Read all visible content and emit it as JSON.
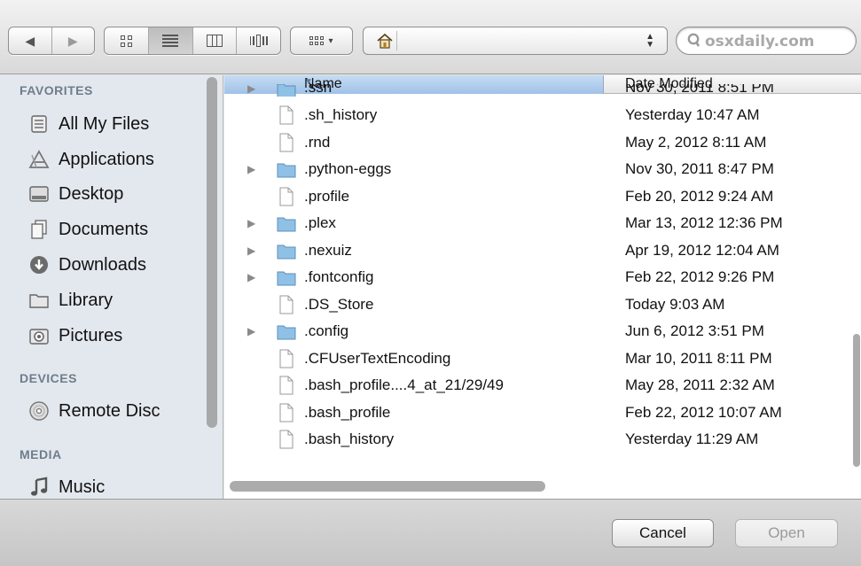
{
  "toolbar": {
    "back_label": "◀",
    "forward_label": "▶",
    "view_modes": [
      "icon",
      "list",
      "column",
      "cover-flow"
    ],
    "active_view": "list",
    "arrange_label": "▾",
    "path": "",
    "search": {
      "value": "",
      "placeholder": "osxdaily.com"
    }
  },
  "sidebar": {
    "sections": [
      {
        "header": "FAVORITES",
        "items": [
          {
            "label": "All My Files",
            "icon": "all-files-icon"
          },
          {
            "label": "Applications",
            "icon": "applications-icon"
          },
          {
            "label": "Desktop",
            "icon": "desktop-icon"
          },
          {
            "label": "Documents",
            "icon": "documents-icon"
          },
          {
            "label": "Downloads",
            "icon": "downloads-icon"
          },
          {
            "label": "Library",
            "icon": "folder-icon"
          },
          {
            "label": "Pictures",
            "icon": "camera-icon"
          }
        ]
      },
      {
        "header": "DEVICES",
        "items": [
          {
            "label": "Remote Disc",
            "icon": "disc-icon"
          }
        ]
      },
      {
        "header": "MEDIA",
        "items": [
          {
            "label": "Music",
            "icon": "music-icon"
          }
        ]
      }
    ]
  },
  "file_list": {
    "columns": {
      "name": "Name",
      "date": "Date Modified"
    },
    "sort_indicator": "▼",
    "partial_row": {
      "name": ".ssh",
      "date": "Nov 30, 2011 8:51 PM",
      "kind": "folder"
    },
    "rows": [
      {
        "name": ".sh_history",
        "date": "Yesterday 10:47 AM",
        "kind": "file"
      },
      {
        "name": ".rnd",
        "date": "May 2, 2012 8:11 AM",
        "kind": "file"
      },
      {
        "name": ".python-eggs",
        "date": "Nov 30, 2011 8:47 PM",
        "kind": "folder"
      },
      {
        "name": ".profile",
        "date": "Feb 20, 2012 9:24 AM",
        "kind": "file"
      },
      {
        "name": ".plex",
        "date": "Mar 13, 2012 12:36 PM",
        "kind": "folder"
      },
      {
        "name": ".nexuiz",
        "date": "Apr 19, 2012 12:04 AM",
        "kind": "folder"
      },
      {
        "name": ".fontconfig",
        "date": "Feb 22, 2012 9:26 PM",
        "kind": "folder"
      },
      {
        "name": ".DS_Store",
        "date": "Today 9:03 AM",
        "kind": "file"
      },
      {
        "name": ".config",
        "date": "Jun 6, 2012 3:51 PM",
        "kind": "folder"
      },
      {
        "name": ".CFUserTextEncoding",
        "date": "Mar 10, 2011 8:11 PM",
        "kind": "file"
      },
      {
        "name": ".bash_profile....4_at_21/29/49",
        "date": "May 28, 2011 2:32 AM",
        "kind": "file"
      },
      {
        "name": ".bash_profile",
        "date": "Feb 22, 2012 10:07 AM",
        "kind": "file"
      },
      {
        "name": ".bash_history",
        "date": "Yesterday 11:29 AM",
        "kind": "file"
      }
    ]
  },
  "footer": {
    "cancel_label": "Cancel",
    "open_label": "Open",
    "open_enabled": false
  },
  "colors": {
    "sidebar_bg": "#e3e8ee",
    "header_selected": "#a9c8ea",
    "folder_blue": "#8fc1e6",
    "section_header": "#6f7d8b"
  }
}
